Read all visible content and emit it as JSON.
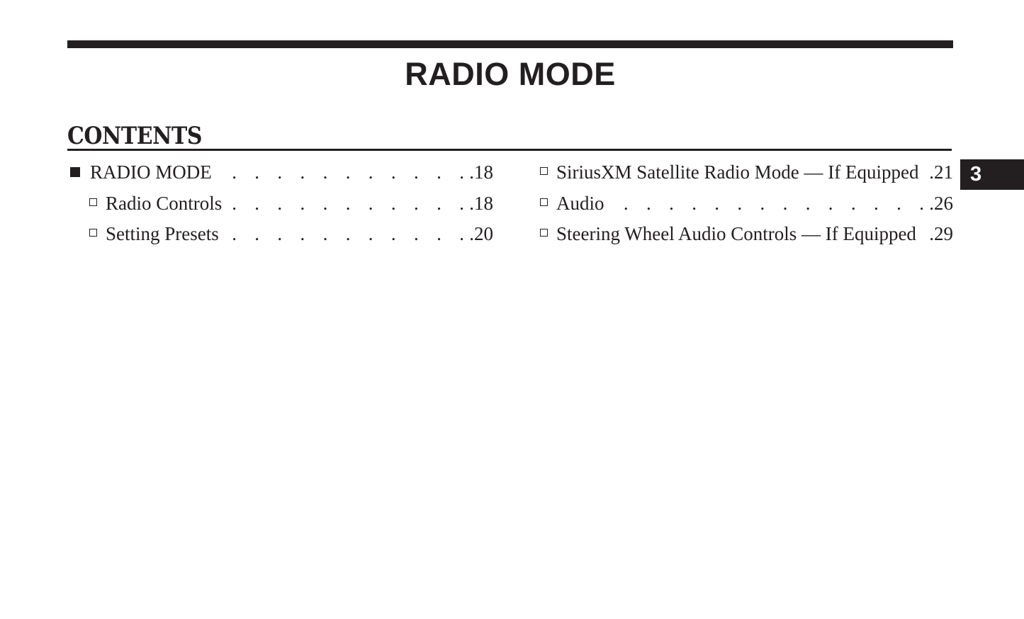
{
  "document": {
    "chapter_title": "RADIO MODE",
    "contents_heading": "CONTENTS",
    "section_tab_number": "3",
    "colors": {
      "ink": "#231f20",
      "paper": "#ffffff",
      "tab_text": "#ffffff"
    }
  },
  "toc": {
    "left_column": [
      {
        "bullet": "filled-square-bullet",
        "level": 1,
        "label": "RADIO MODE",
        "leader": ". . . . . . . . . . . . . . . . . . . . . .",
        "page": ".18"
      },
      {
        "bullet": "open-square-bullet",
        "level": 2,
        "label": "Radio Controls",
        "leader": ". . . . . . . . . . . . . . . . . . . .",
        "page": ".18"
      },
      {
        "bullet": "open-square-bullet",
        "level": 2,
        "label": "Setting Presets",
        "leader": ". . . . . . . . . . . . . . . . . . . .",
        "page": ".20"
      }
    ],
    "right_column": [
      {
        "bullet": "open-square-bullet",
        "level": 2,
        "label": "SiriusXM Satellite Radio Mode — If Equipped",
        "leader": ". .",
        "page": ".21"
      },
      {
        "bullet": "open-square-bullet",
        "level": 2,
        "label": "Audio",
        "leader": ". . . . . . . . . . . . . . . . . . . . . . . .",
        "page": ".26"
      },
      {
        "bullet": "open-square-bullet",
        "level": 2,
        "label": "Steering Wheel Audio Controls — If Equipped",
        "leader": ".",
        "page": ".29"
      }
    ]
  }
}
